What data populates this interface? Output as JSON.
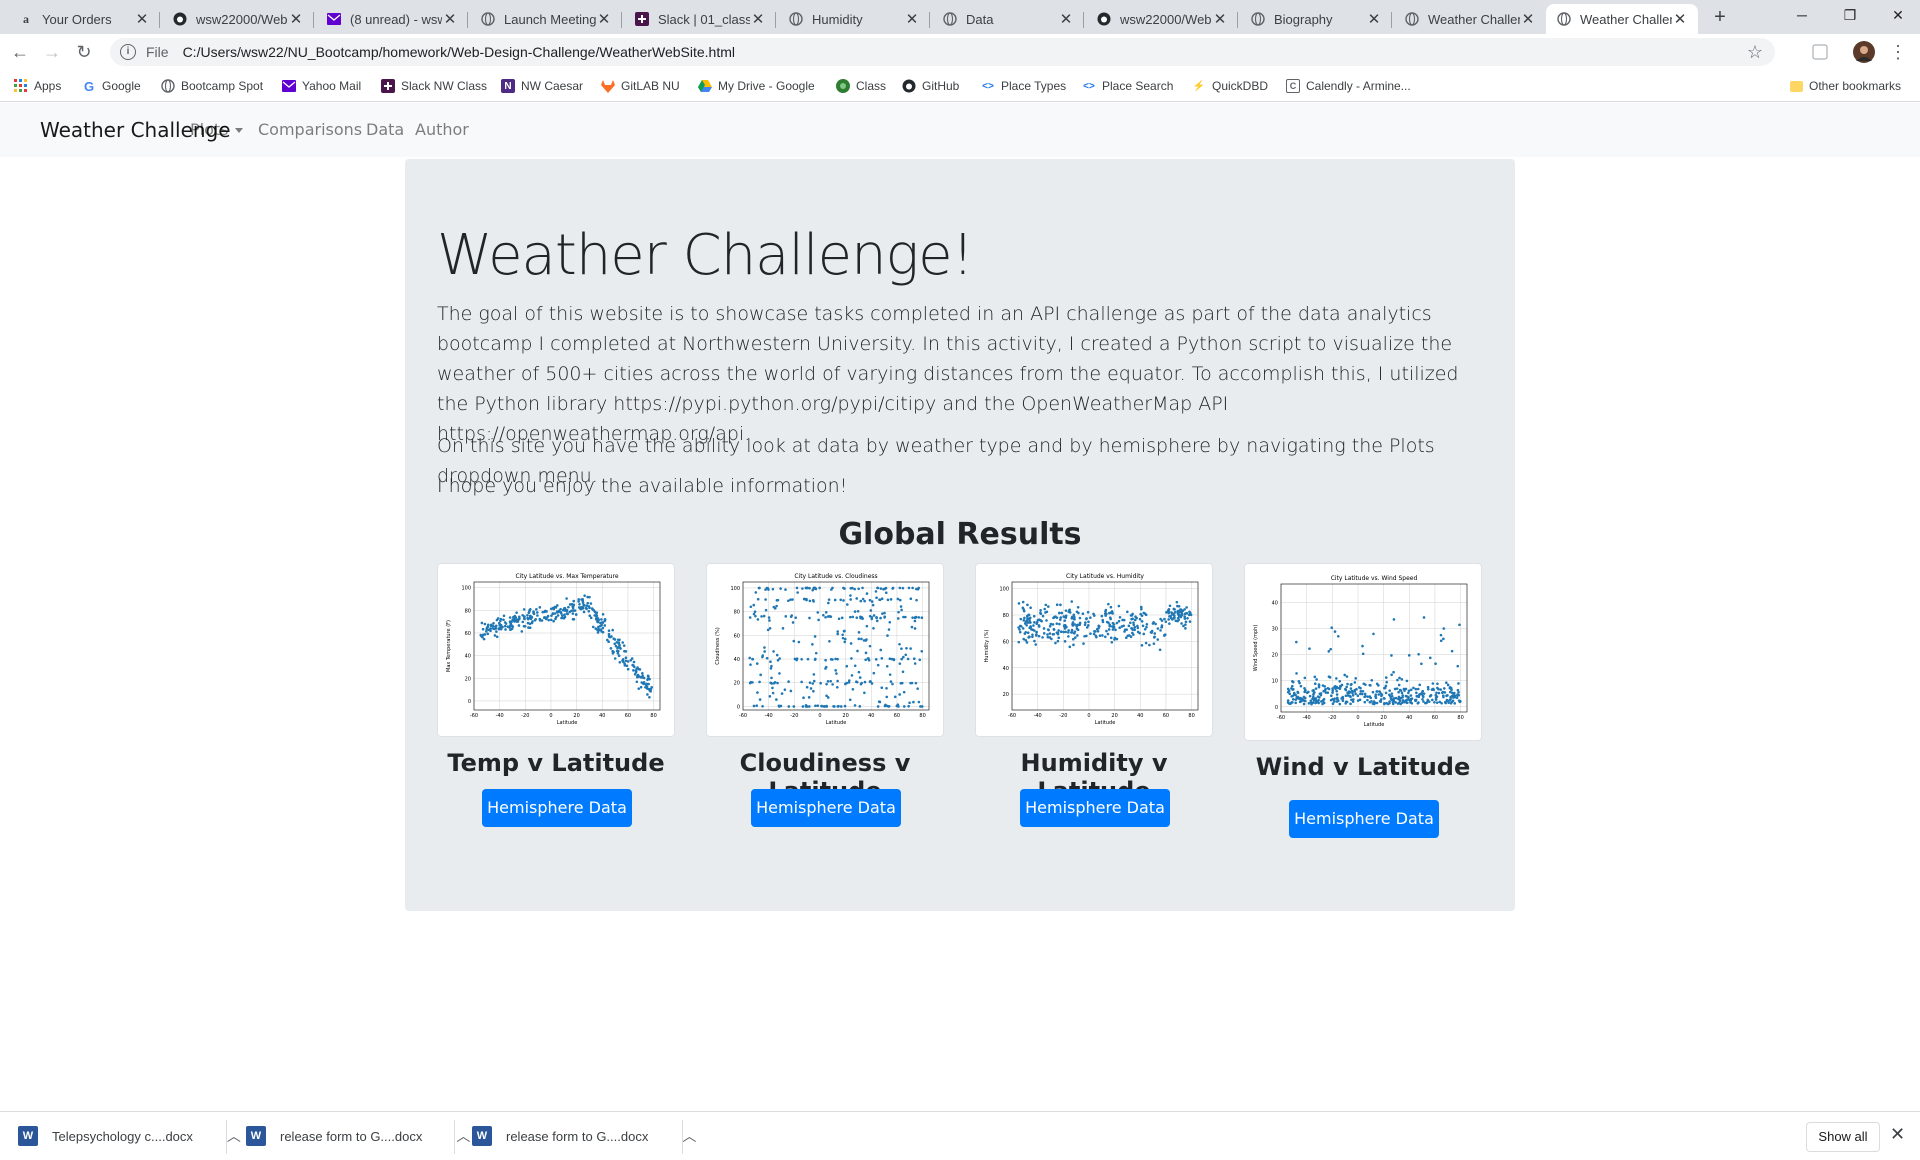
{
  "browser": {
    "tabs": [
      {
        "title": "Your Orders",
        "icon": "amazon-icon"
      },
      {
        "title": "wsw22000/Web-",
        "icon": "github-icon"
      },
      {
        "title": "(8 unread) - wsw",
        "icon": "yahoo-mail-icon"
      },
      {
        "title": "Launch Meeting",
        "icon": "globe-icon"
      },
      {
        "title": "Slack | 01_class_a",
        "icon": "slack-icon"
      },
      {
        "title": "Humidity",
        "icon": "globe-icon"
      },
      {
        "title": "Data",
        "icon": "globe-icon"
      },
      {
        "title": "wsw22000/Web-",
        "icon": "github-icon"
      },
      {
        "title": "Biography",
        "icon": "globe-icon"
      },
      {
        "title": "Weather Challen",
        "icon": "globe-icon"
      },
      {
        "title": "Weather Challen",
        "icon": "globe-icon"
      }
    ],
    "new_tab": "+",
    "address_scheme": "File",
    "address_url": "C:/Users/wsw22/NU_Bootcamp/homework/Web-Design-Challenge/WeatherWebSite.html",
    "bookmarks": [
      {
        "label": "Apps",
        "icon": "apps-grid-icon"
      },
      {
        "label": "Google",
        "icon": "google-icon"
      },
      {
        "label": "Bootcamp Spot",
        "icon": "globe-icon"
      },
      {
        "label": "Yahoo Mail",
        "icon": "yahoo-mail-icon"
      },
      {
        "label": "Slack NW Class",
        "icon": "slack-icon"
      },
      {
        "label": "NW Caesar",
        "icon": "northwestern-icon"
      },
      {
        "label": "GitLAB NU",
        "icon": "gitlab-icon"
      },
      {
        "label": "My Drive - Google",
        "icon": "google-drive-icon"
      },
      {
        "label": "Class",
        "icon": "class-icon"
      },
      {
        "label": "GitHub",
        "icon": "github-icon"
      },
      {
        "label": "Place Types",
        "icon": "code-icon"
      },
      {
        "label": "Place Search",
        "icon": "code-icon"
      },
      {
        "label": "QuickDBD",
        "icon": "lightning-icon"
      },
      {
        "label": "Calendly - Armine...",
        "icon": "calendly-icon"
      }
    ],
    "other_bookmarks": "Other bookmarks"
  },
  "site": {
    "brand": "Weather Challenge",
    "nav": {
      "plots": "Plots",
      "comparisons": "Comparisons",
      "data": "Data",
      "author": "Author"
    },
    "heading": "Weather Challenge!",
    "intro": "The goal of this website is to showcase tasks completed in an API challenge as part of the data analytics bootcamp I completed at Northwestern University. In this activity, I created a Python script to visualize the weather of 500+ cities across the world of varying distances from the equator. To accomplish this, I utilized the Python library https://pypi.python.org/pypi/citipy and the OpenWeatherMap API https://openweathermap.org/api.",
    "para2": "On this site you have the ability look at data by weather type and by hemisphere by navigating the Plots dropdown menu.",
    "para3": "I hope you enjoy the available information!",
    "section_title": "Global Results",
    "button_label": "Hemisphere Data",
    "cards": [
      {
        "title": "Temp v Latitude",
        "plot_title": "City Latitude vs. Max Temperature",
        "ylabel": "Max Temperature (F)",
        "xlabel": "Latitude"
      },
      {
        "title": "Cloudiness v Latitude",
        "plot_title": "City Latitude vs. Cloudiness",
        "ylabel": "Cloudiness (%)",
        "xlabel": "Latitude"
      },
      {
        "title": "Humidity v Latitude",
        "plot_title": "City Latitude vs. Humidity",
        "ylabel": "Humidity (%)",
        "xlabel": "Latitude"
      },
      {
        "title": "Wind v Latitude",
        "plot_title": "City Latitude vs. Wind Speed",
        "ylabel": "Wind Speed (mph)",
        "xlabel": "Latitude"
      }
    ]
  },
  "downloads": {
    "items": [
      "Telepsychology c....docx",
      "release form to G....docx",
      "release form to G....docx"
    ],
    "show_all": "Show all"
  },
  "chart_data": [
    {
      "type": "scatter",
      "title": "City Latitude vs. Max Temperature",
      "xlabel": "Latitude",
      "ylabel": "Max Temperature (F)",
      "xticks": [
        -60,
        -40,
        -20,
        0,
        20,
        40,
        60,
        80
      ],
      "yticks": [
        0,
        20,
        40,
        60,
        80,
        100
      ],
      "xlim": [
        -60,
        85
      ],
      "ylim": [
        -8,
        105
      ],
      "grid": true,
      "shape": "temp"
    },
    {
      "type": "scatter",
      "title": "City Latitude vs. Cloudiness",
      "xlabel": "Latitude",
      "ylabel": "Cloudiness (%)",
      "xticks": [
        -60,
        -40,
        -20,
        0,
        20,
        40,
        60,
        80
      ],
      "yticks": [
        0,
        20,
        40,
        60,
        80,
        100
      ],
      "xlim": [
        -60,
        85
      ],
      "ylim": [
        -3,
        105
      ],
      "grid": true,
      "shape": "cloud"
    },
    {
      "type": "scatter",
      "title": "City Latitude vs. Humidity",
      "xlabel": "Latitude",
      "ylabel": "Humidity (%)",
      "xticks": [
        -60,
        -40,
        -20,
        0,
        20,
        40,
        60,
        80
      ],
      "yticks": [
        20,
        40,
        60,
        80,
        100
      ],
      "xlim": [
        -60,
        85
      ],
      "ylim": [
        8,
        105
      ],
      "grid": true,
      "shape": "humid"
    },
    {
      "type": "scatter",
      "title": "City Latitude vs. Wind Speed",
      "xlabel": "Latitude",
      "ylabel": "Wind Speed (mph)",
      "xticks": [
        -60,
        -40,
        -20,
        0,
        20,
        40,
        60,
        80
      ],
      "yticks": [
        0,
        10,
        20,
        30,
        40
      ],
      "xlim": [
        -60,
        85
      ],
      "ylim": [
        -2,
        47
      ],
      "grid": true,
      "shape": "wind"
    }
  ]
}
